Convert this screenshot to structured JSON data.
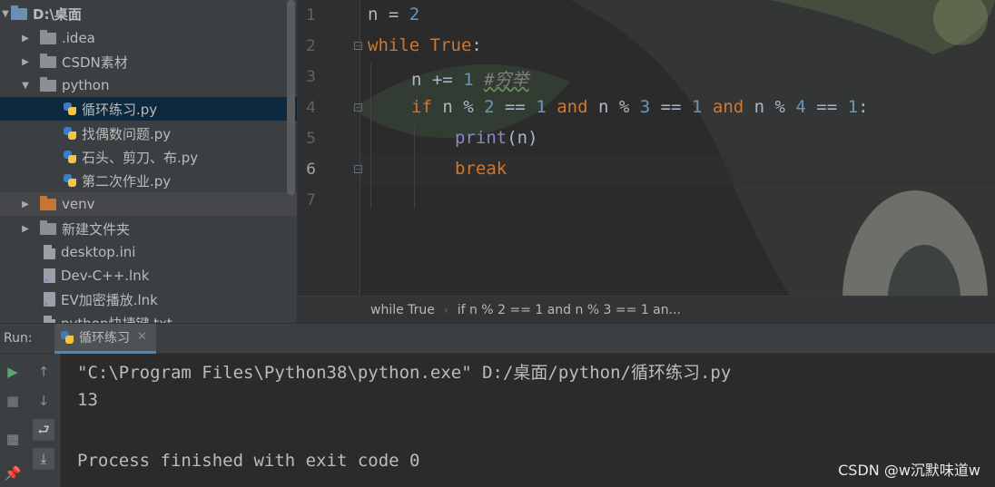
{
  "project_tree": {
    "root": "D:\\桌面",
    "items": [
      {
        "label": ".idea",
        "type": "folder",
        "expanded": false
      },
      {
        "label": "CSDN素材",
        "type": "folder",
        "expanded": false
      },
      {
        "label": "python",
        "type": "folder",
        "expanded": true
      },
      {
        "label": "循环练习.py",
        "type": "python-file",
        "selected": true
      },
      {
        "label": "找偶数问题.py",
        "type": "python-file"
      },
      {
        "label": "石头、剪刀、布.py",
        "type": "python-file"
      },
      {
        "label": "第二次作业.py",
        "type": "python-file"
      },
      {
        "label": "venv",
        "type": "folder-orange",
        "expanded": false
      },
      {
        "label": "新建文件夹",
        "type": "folder",
        "expanded": false
      },
      {
        "label": "desktop.ini",
        "type": "file"
      },
      {
        "label": "Dev-C++.lnk",
        "type": "shortcut"
      },
      {
        "label": "EV加密播放.lnk",
        "type": "shortcut"
      },
      {
        "label": "python快捷键.txt",
        "type": "file"
      }
    ]
  },
  "editor": {
    "line_numbers": [
      "1",
      "2",
      "3",
      "4",
      "5",
      "6",
      "7"
    ],
    "active_line": "6",
    "code": {
      "l1_a": "n = ",
      "l1_b": "2",
      "l2_kw": "while",
      "l2_true": "True",
      "l2_colon": ":",
      "l3_a": "n += ",
      "l3_num": "1",
      "l3_cmt": "#穷举",
      "l4_if": "if",
      "l4_n1": " n % ",
      "l4_2": "2",
      "l4_eq1": " == ",
      "l4_1a": "1",
      "l4_and1": "and",
      "l4_n2": " n % ",
      "l4_3": "3",
      "l4_eq2": " == ",
      "l4_1b": "1",
      "l4_and2": "and",
      "l4_n3": " n % ",
      "l4_4": "4",
      "l4_eq3": " == ",
      "l4_1c": "1",
      "l4_colon": ":",
      "l5_print": "print",
      "l5_args": "(n)",
      "l6_break": "break"
    },
    "breadcrumb": [
      "while True",
      "if n % 2 == 1 and n % 3 == 1 an..."
    ]
  },
  "run": {
    "label": "Run:",
    "tab": "循环练习",
    "output": [
      "\"C:\\Program Files\\Python38\\python.exe\" D:/桌面/python/循环练习.py",
      "13",
      "",
      "Process finished with exit code 0"
    ]
  },
  "watermark": "CSDN @w沉默味道w",
  "colors": {
    "keyword": "#cc7832",
    "number": "#6897bb",
    "builtin": "#8888c6",
    "comment": "#808080",
    "selection": "#0d293e",
    "run_icon": "#59a869"
  }
}
